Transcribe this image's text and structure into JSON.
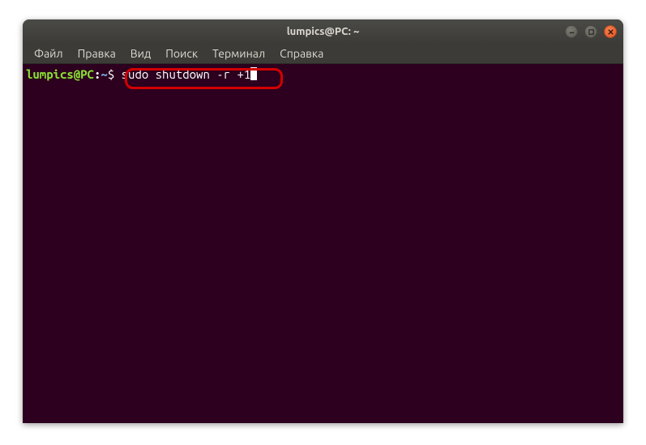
{
  "window": {
    "title": "lumpics@PC: ~"
  },
  "menubar": {
    "items": [
      "Файл",
      "Правка",
      "Вид",
      "Поиск",
      "Терминал",
      "Справка"
    ]
  },
  "prompt": {
    "user_host": "lumpics@PC",
    "sep": ":",
    "path": "~",
    "symbol": "$"
  },
  "command": "sudo shutdown -r +1",
  "controls": {
    "min_name": "minimize-icon",
    "max_name": "maximize-icon",
    "close_name": "close-icon"
  }
}
